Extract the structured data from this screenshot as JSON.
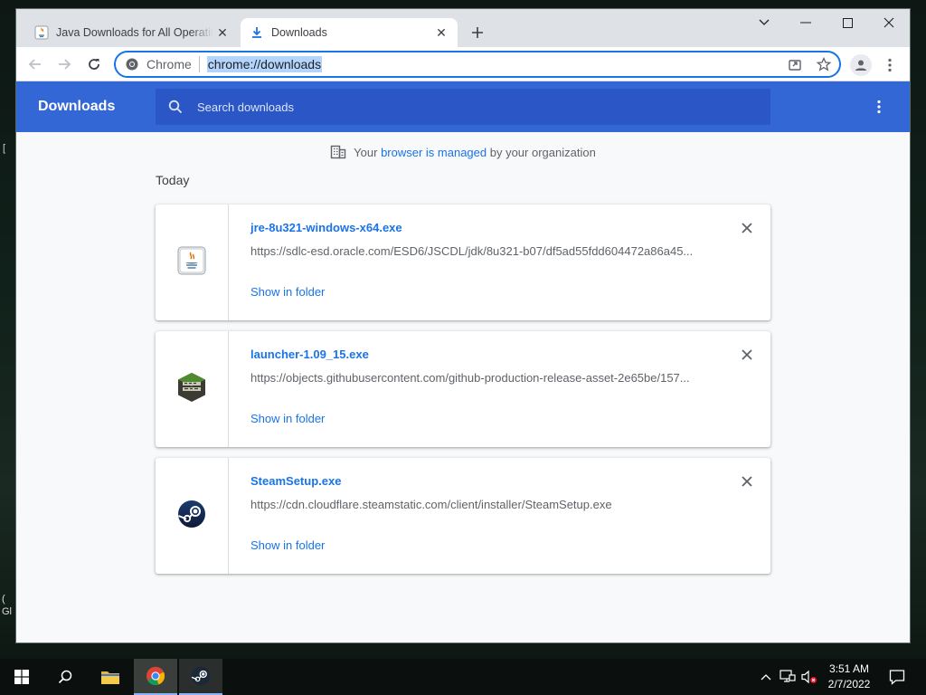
{
  "browser": {
    "tabs": [
      {
        "title": "Java Downloads for All Operating Systems",
        "icon": "java-icon",
        "active": false
      },
      {
        "title": "Downloads",
        "icon": "download-icon",
        "active": true
      }
    ],
    "omnibox": {
      "site_label": "Chrome",
      "url": "chrome://downloads"
    }
  },
  "downloads_page": {
    "title": "Downloads",
    "search_placeholder": "Search downloads",
    "managed_notice": {
      "prefix": "Your ",
      "link": "browser is managed",
      "suffix": " by your organization"
    },
    "section_label": "Today",
    "items": [
      {
        "filename": "jre-8u321-windows-x64.exe",
        "url": "https://sdlc-esd.oracle.com/ESD6/JSCDL/jdk/8u321-b07/df5ad55fdd604472a86a45...",
        "action": "Show in folder",
        "icon": "java-file-icon"
      },
      {
        "filename": "launcher-1.09_15.exe",
        "url": "https://objects.githubusercontent.com/github-production-release-asset-2e65be/157...",
        "action": "Show in folder",
        "icon": "betacraft-icon"
      },
      {
        "filename": "SteamSetup.exe",
        "url": "https://cdn.cloudflare.steamstatic.com/client/installer/SteamSetup.exe",
        "action": "Show in folder",
        "icon": "steam-icon"
      }
    ]
  },
  "taskbar": {
    "time": "3:51 AM",
    "date": "2/7/2022"
  },
  "desktop": {
    "left_edge_text": "(\nGl",
    "left_edge_mark": "["
  },
  "colors": {
    "accent": "#1a73e8",
    "header_blue": "#3367d6",
    "search_blue": "#2a56c6"
  }
}
